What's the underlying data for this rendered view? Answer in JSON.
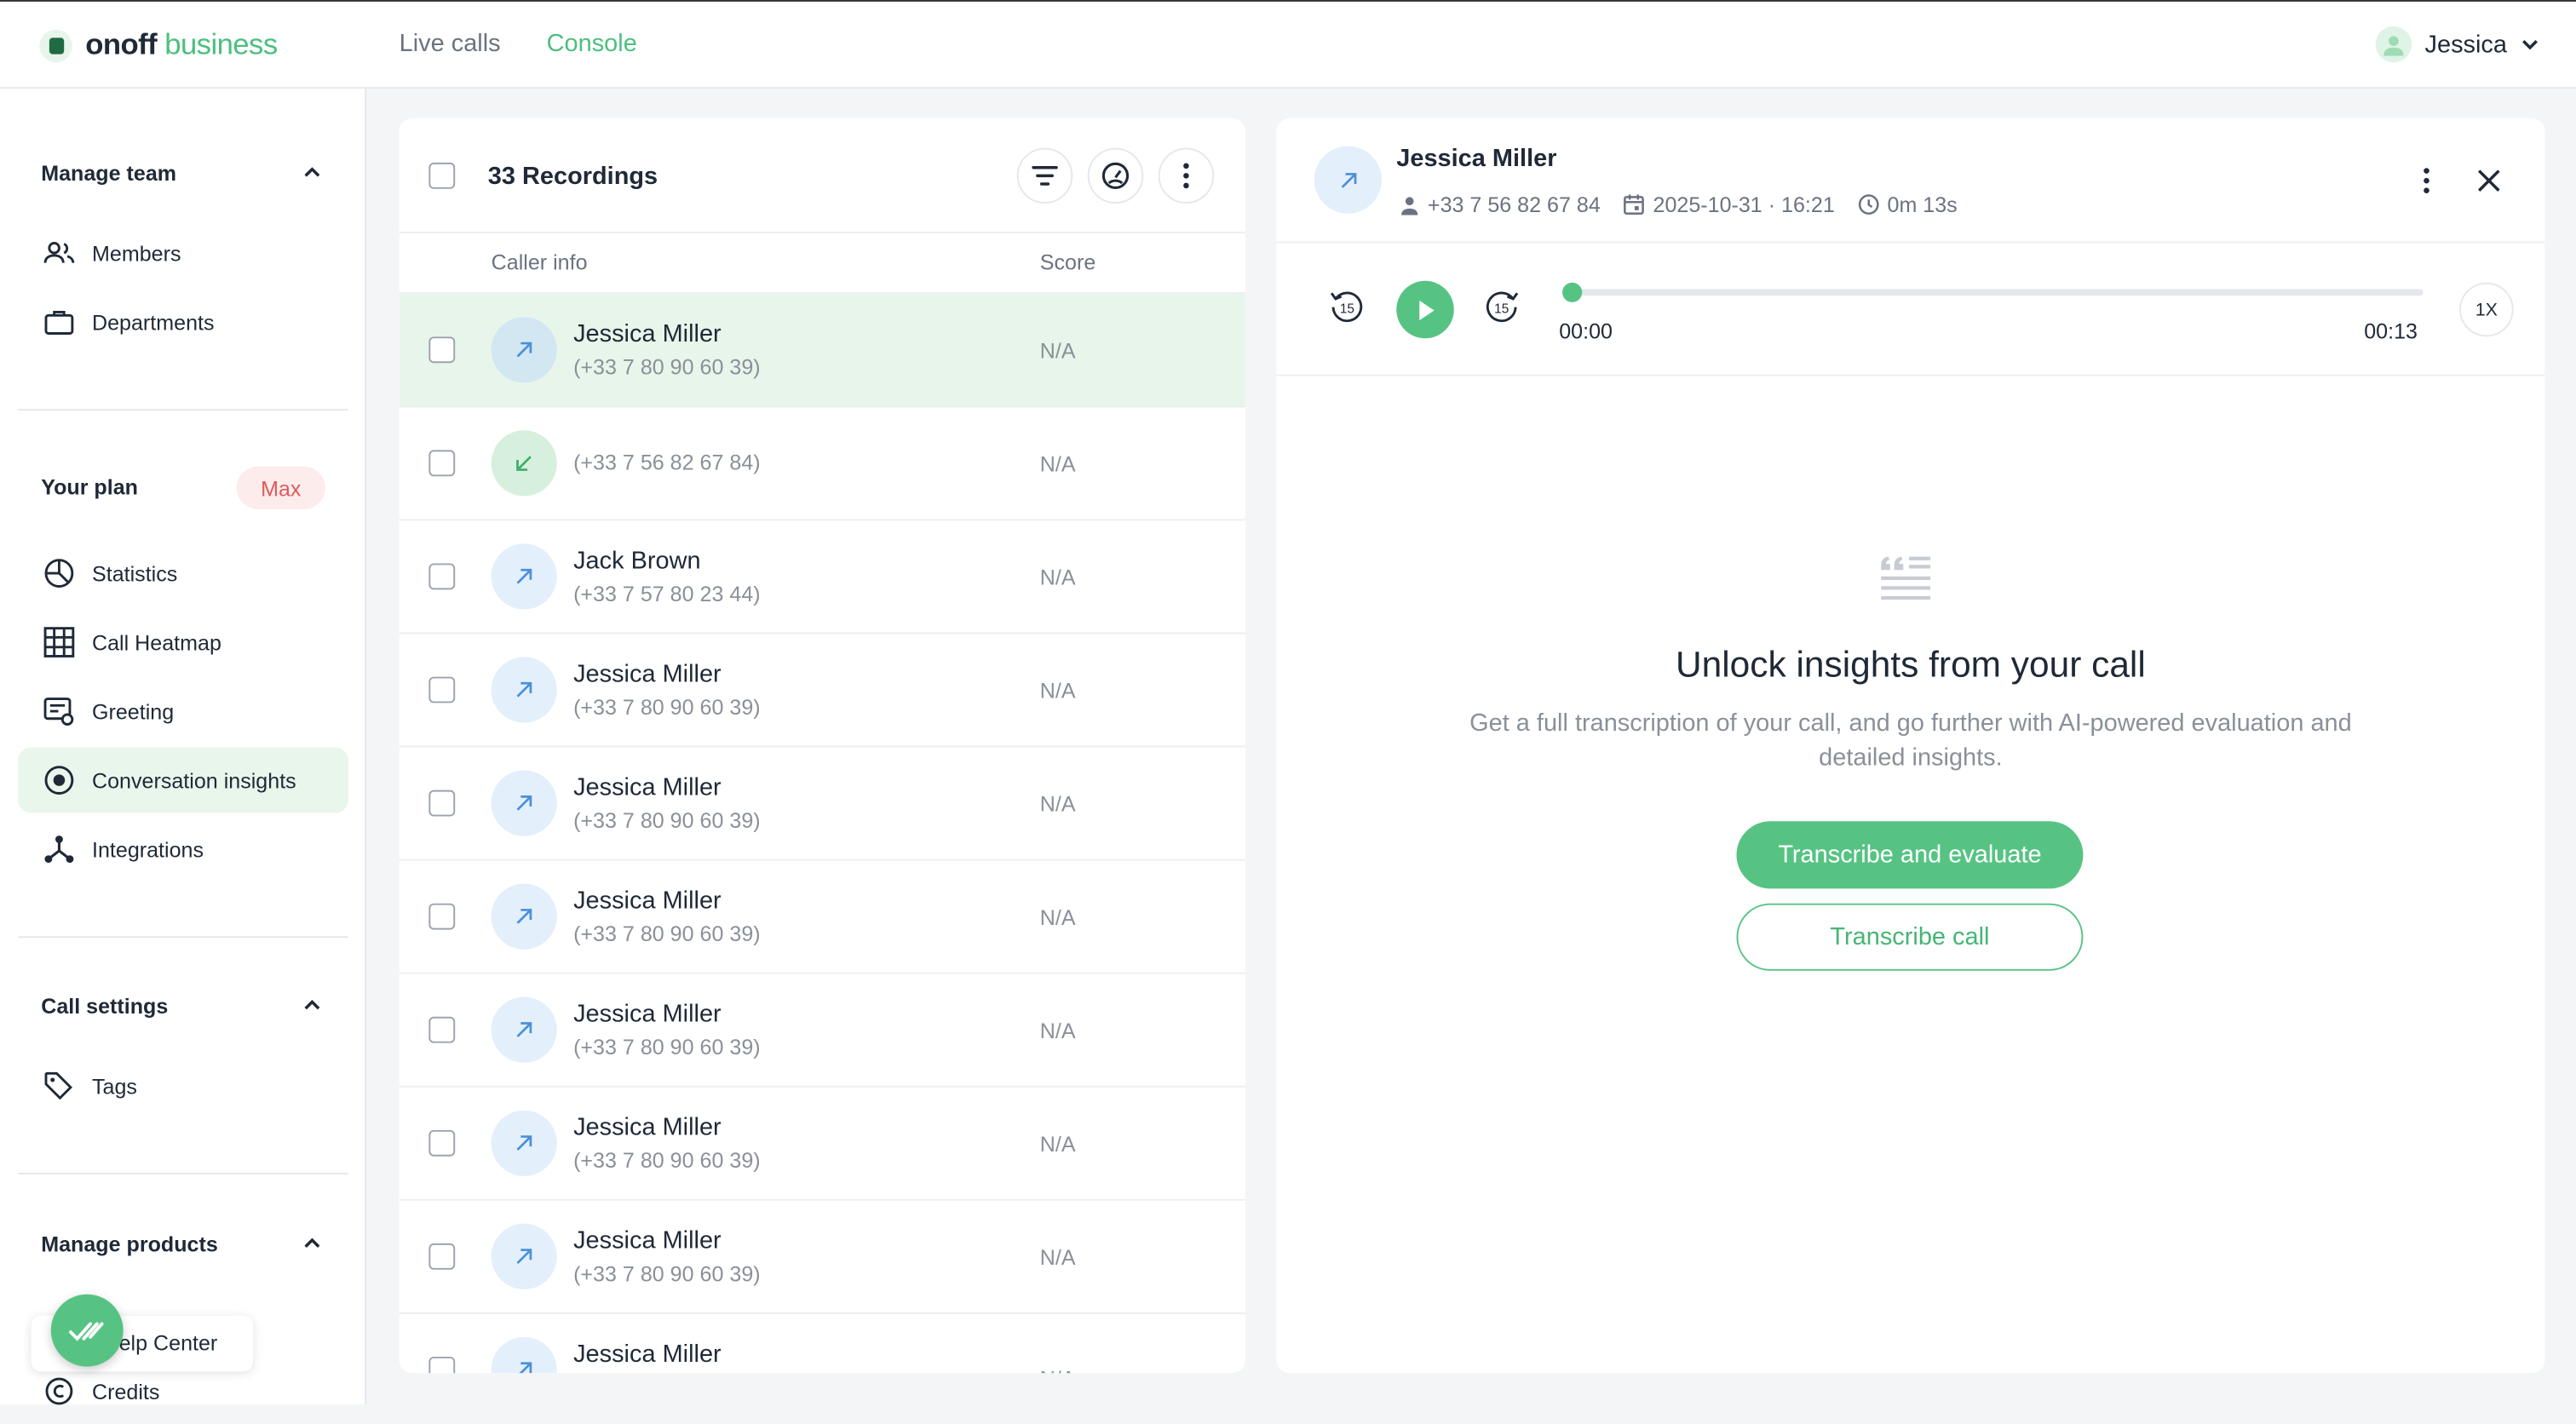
{
  "brand": {
    "name": "onoff",
    "suffix": " business"
  },
  "nav": {
    "live_calls": "Live calls",
    "console": "Console"
  },
  "user": {
    "name": "Jessica"
  },
  "sidebar": {
    "manage_team": {
      "title": "Manage team",
      "items": [
        "Members",
        "Departments"
      ]
    },
    "your_plan": {
      "title": "Your plan",
      "badge": "Max",
      "items": [
        "Statistics",
        "Call Heatmap",
        "Greeting",
        "Conversation insights",
        "Integrations"
      ]
    },
    "call_settings": {
      "title": "Call settings",
      "items": [
        "Tags"
      ]
    },
    "manage_products": {
      "title": "Manage products",
      "items": [
        "Help Center",
        "Credits"
      ]
    },
    "active_item": "Conversation insights"
  },
  "recordings": {
    "count_label": "33 Recordings",
    "col_caller": "Caller info",
    "col_score": "Score",
    "rows": [
      {
        "name": "Jessica Miller",
        "phone": "(+33 7 80 90 60 39)",
        "score": "N/A",
        "direction": "outgoing",
        "selected": true
      },
      {
        "name": "",
        "phone": "(+33 7 56 82 67 84)",
        "score": "N/A",
        "direction": "incoming",
        "selected": false
      },
      {
        "name": "Jack Brown",
        "phone": "(+33 7 57 80 23 44)",
        "score": "N/A",
        "direction": "outgoing",
        "selected": false
      },
      {
        "name": "Jessica Miller",
        "phone": "(+33 7 80 90 60 39)",
        "score": "N/A",
        "direction": "outgoing",
        "selected": false
      },
      {
        "name": "Jessica Miller",
        "phone": "(+33 7 80 90 60 39)",
        "score": "N/A",
        "direction": "outgoing",
        "selected": false
      },
      {
        "name": "Jessica Miller",
        "phone": "(+33 7 80 90 60 39)",
        "score": "N/A",
        "direction": "outgoing",
        "selected": false
      },
      {
        "name": "Jessica Miller",
        "phone": "(+33 7 80 90 60 39)",
        "score": "N/A",
        "direction": "outgoing",
        "selected": false
      },
      {
        "name": "Jessica Miller",
        "phone": "(+33 7 80 90 60 39)",
        "score": "N/A",
        "direction": "outgoing",
        "selected": false
      },
      {
        "name": "Jessica Miller",
        "phone": "(+33 7 80 90 60 39)",
        "score": "N/A",
        "direction": "outgoing",
        "selected": false
      },
      {
        "name": "Jessica Miller",
        "phone": "",
        "score": "N/A",
        "direction": "outgoing",
        "selected": false
      }
    ]
  },
  "detail": {
    "name": "Jessica Miller",
    "phone": "+33 7 56 82 67 84",
    "datetime": "2025-10-31 · 16:21",
    "duration": "0m 13s",
    "player": {
      "current": "00:00",
      "total": "00:13",
      "speed": "1X",
      "progress": 0,
      "skip_seconds": "15"
    },
    "empty_title": "Unlock insights from your call",
    "empty_subtitle": "Get a full transcription of your call, and go further with AI-powered evaluation and detailed insights.",
    "btn_transcribe_evaluate": "Transcribe and evaluate",
    "btn_transcribe": "Transcribe call"
  },
  "colors": {
    "accent": "#56c383",
    "selected_row": "#e8f5ea",
    "danger_badge": "#e05a5a"
  }
}
